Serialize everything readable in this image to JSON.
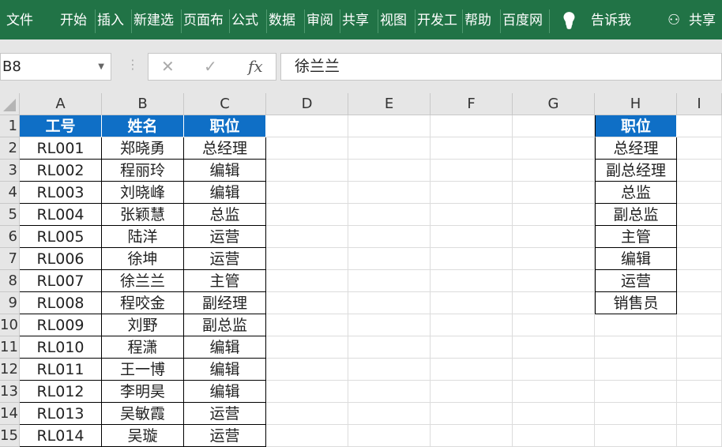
{
  "ribbon": {
    "tabs": [
      "文件",
      "开始",
      "插入",
      "新建选",
      "页面布",
      "公式",
      "数据",
      "审阅",
      "共享",
      "视图",
      "开发工",
      "帮助",
      "百度网"
    ],
    "tell_me": "告诉我",
    "share": "共享"
  },
  "formula_bar": {
    "name_box": "B8",
    "formula": "徐兰兰",
    "fx": "fx"
  },
  "columns": [
    "A",
    "B",
    "C",
    "D",
    "E",
    "F",
    "G",
    "H",
    "I"
  ],
  "table": {
    "headers": [
      "工号",
      "姓名",
      "职位"
    ],
    "rows": [
      [
        "RL001",
        "郑晓勇",
        "总经理"
      ],
      [
        "RL002",
        "程丽玲",
        "编辑"
      ],
      [
        "RL003",
        "刘晓峰",
        "编辑"
      ],
      [
        "RL004",
        "张颖慧",
        "总监"
      ],
      [
        "RL005",
        "陆洋",
        "运营"
      ],
      [
        "RL006",
        "徐坤",
        "运营"
      ],
      [
        "RL007",
        "徐兰兰",
        "主管"
      ],
      [
        "RL008",
        "程咬金",
        "副经理"
      ],
      [
        "RL009",
        "刘野",
        "副总监"
      ],
      [
        "RL010",
        "程潇",
        "编辑"
      ],
      [
        "RL011",
        "王一博",
        "编辑"
      ],
      [
        "RL012",
        "李明昊",
        "编辑"
      ],
      [
        "RL013",
        "吴敏霞",
        "运营"
      ],
      [
        "RL014",
        "吴璇",
        "运营"
      ]
    ]
  },
  "positions": {
    "header": "职位",
    "items": [
      "总经理",
      "副总经理",
      "总监",
      "副总监",
      "主管",
      "编辑",
      "运营",
      "销售员"
    ]
  }
}
